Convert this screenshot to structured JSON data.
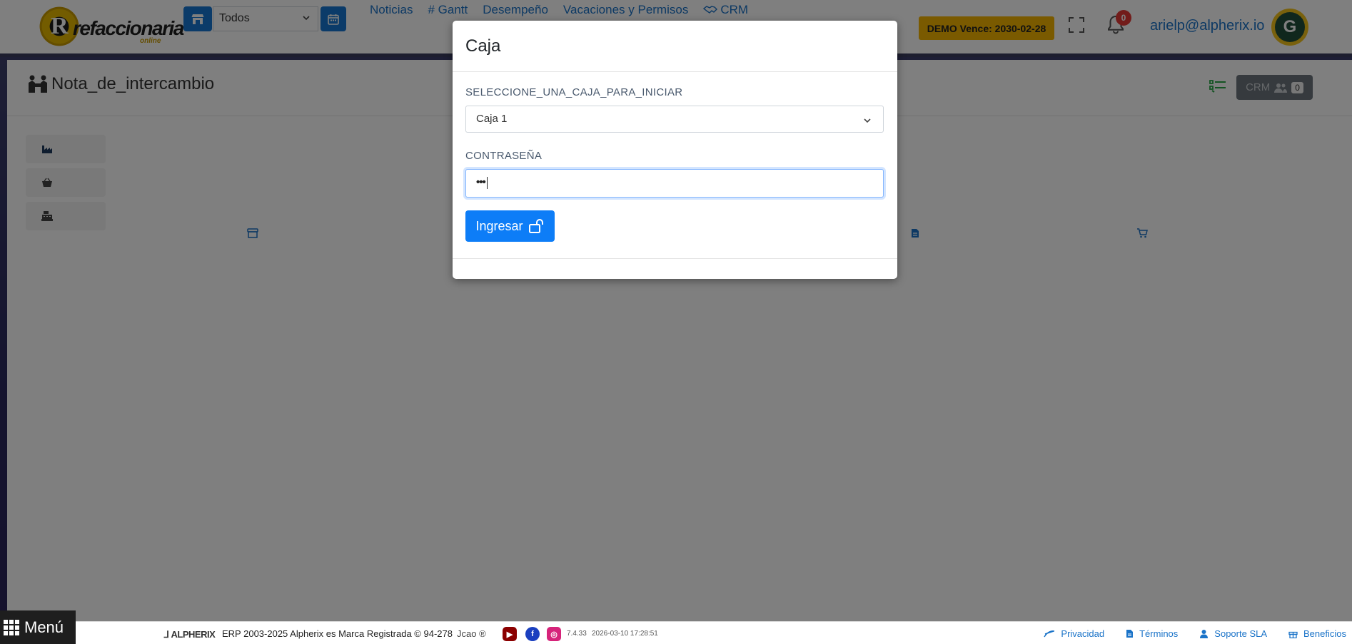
{
  "header": {
    "logo_initial": "R",
    "logo_text": "refaccionaria",
    "logo_sub": "online",
    "store_select_value": "Todos",
    "nav": [
      {
        "label": "Noticias"
      },
      {
        "label": "# Gantt"
      },
      {
        "label": "Desempeño"
      },
      {
        "label": "Vacaciones y Permisos"
      },
      {
        "label": "CRM"
      }
    ],
    "demo_badge": "DEMO Vence: 2030-02-28",
    "notifications_count": "0",
    "user_email": "arielp@alpherix.io",
    "avatar_letter": "G"
  },
  "page": {
    "title": "Nota_de_intercambio",
    "crm_button_label": "CRM",
    "crm_count": "0"
  },
  "modal": {
    "title": "Caja",
    "select_label": "SELECCIONE_UNA_CAJA_PARA_INICIAR",
    "select_value": "Caja 1",
    "password_label": "CONTRASEÑA",
    "password_value": "•••",
    "submit_label": "Ingresar"
  },
  "menu": {
    "label": "Menú"
  },
  "footer": {
    "brand": "ALPHERIX",
    "copyright": "ERP 2003-2025 Alpherix es Marca Registrada © 94-278",
    "extra": "Jcao ®",
    "version": "7.4.33",
    "timestamp": "2026-03-10 17:28:51",
    "links": [
      {
        "label": "Privacidad"
      },
      {
        "label": "Términos"
      },
      {
        "label": "Soporte SLA"
      },
      {
        "label": "Beneficios"
      }
    ]
  },
  "colors": {
    "primary": "#0d7df7",
    "demo_badge": "#f4b400",
    "notification": "#e53935",
    "link": "#1a73c8"
  }
}
